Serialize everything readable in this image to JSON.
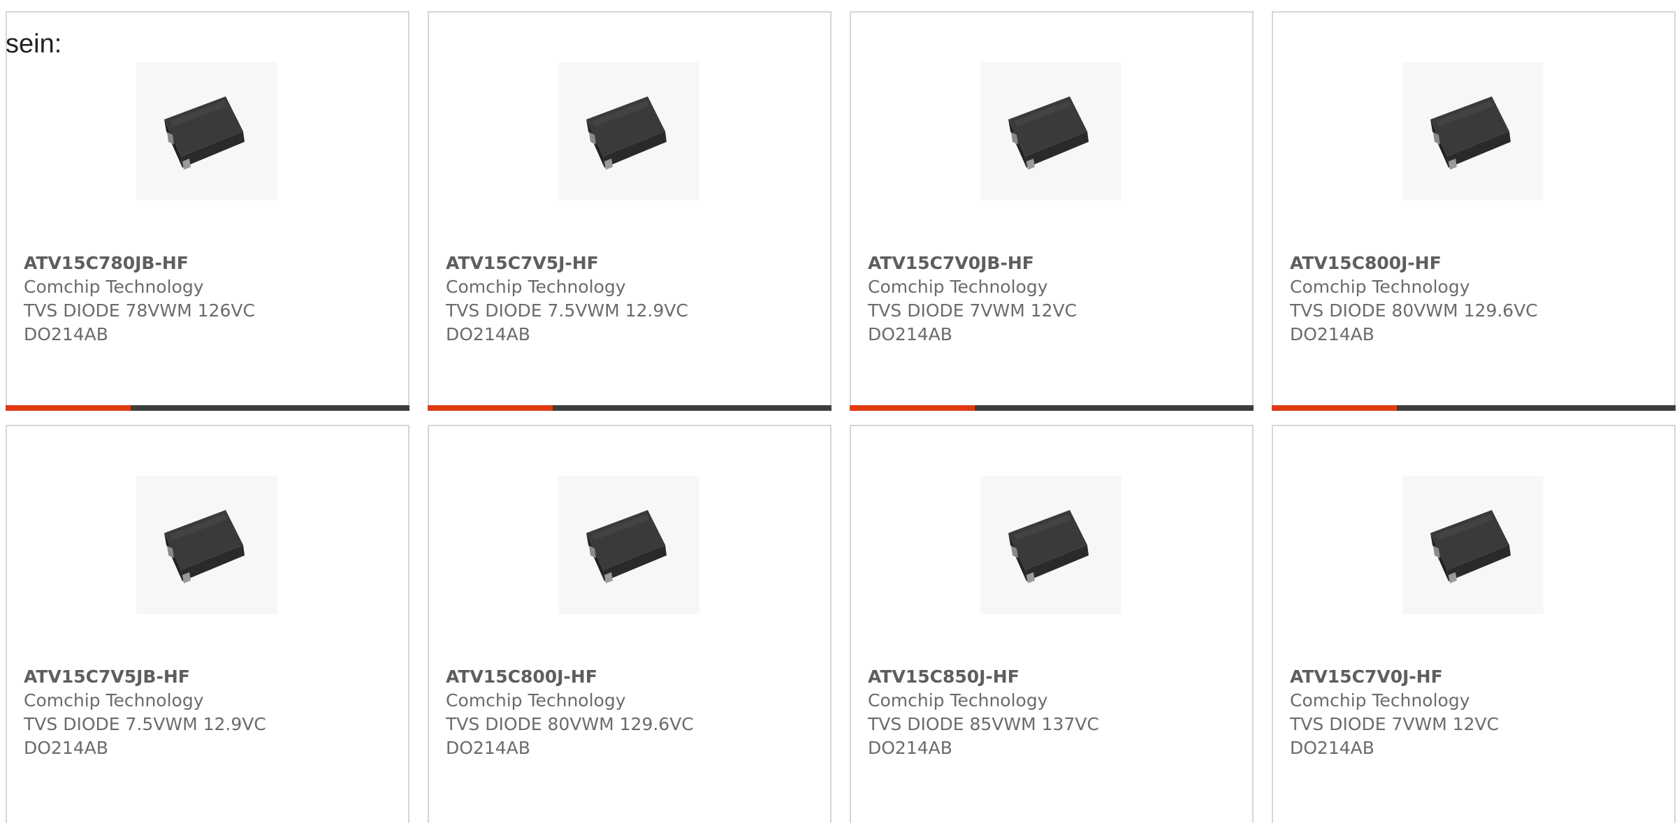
{
  "page": {
    "label": "sein:"
  },
  "colors": {
    "accent": "#e03a12",
    "bar_track": "#3d3d3d",
    "card_border": "#d6d6d6",
    "text": "#6b6b6b"
  },
  "products": [
    {
      "part": "ATV15C780JB-HF",
      "manufacturer": "Comchip Technology",
      "description": "TVS DIODE 78VWM 126VC",
      "package": "DO214AB",
      "image_icon": "diode-package-image",
      "progress": 0.31
    },
    {
      "part": "ATV15C7V5J-HF",
      "manufacturer": "Comchip Technology",
      "description": "TVS DIODE 7.5VWM 12.9VC",
      "package": "DO214AB",
      "image_icon": "diode-package-image",
      "progress": 0.31
    },
    {
      "part": "ATV15C7V0JB-HF",
      "manufacturer": "Comchip Technology",
      "description": "TVS DIODE 7VWM 12VC",
      "package": "DO214AB",
      "image_icon": "diode-package-image",
      "progress": 0.31
    },
    {
      "part": "ATV15C800J-HF",
      "manufacturer": "Comchip Technology",
      "description": "TVS DIODE 80VWM 129.6VC",
      "package": "DO214AB",
      "image_icon": "diode-package-image",
      "progress": 0.31
    },
    {
      "part": "ATV15C7V5JB-HF",
      "manufacturer": "Comchip Technology",
      "description": "TVS DIODE 7.5VWM 12.9VC",
      "package": "DO214AB",
      "image_icon": "diode-package-image"
    },
    {
      "part": "ATV15C800J-HF",
      "manufacturer": "Comchip Technology",
      "description": "TVS DIODE 80VWM 129.6VC",
      "package": "DO214AB",
      "image_icon": "diode-package-image"
    },
    {
      "part": "ATV15C850J-HF",
      "manufacturer": "Comchip Technology",
      "description": "TVS DIODE 85VWM 137VC",
      "package": "DO214AB",
      "image_icon": "diode-package-image"
    },
    {
      "part": "ATV15C7V0J-HF",
      "manufacturer": "Comchip Technology",
      "description": "TVS DIODE 7VWM 12VC",
      "package": "DO214AB",
      "image_icon": "diode-package-image"
    }
  ]
}
